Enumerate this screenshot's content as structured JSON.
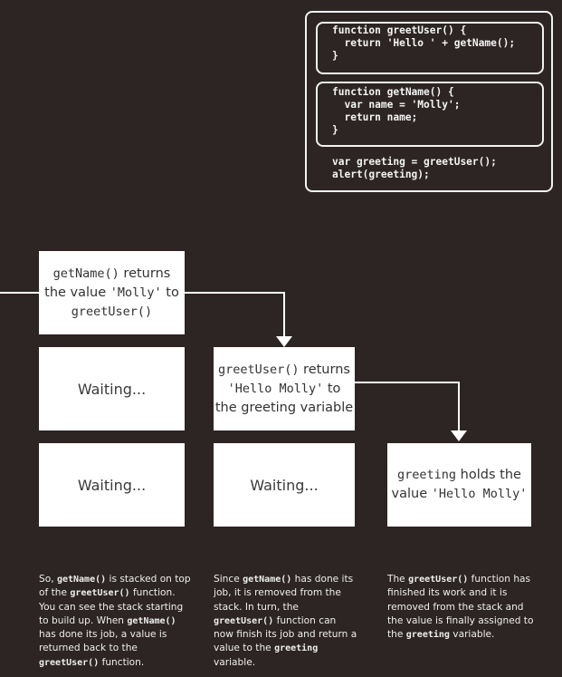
{
  "code": {
    "greet_user_lines": [
      "function greetUser() {",
      "  return 'Hello ' + getName();",
      "}"
    ],
    "get_name_lines": [
      "function getName() {",
      "  var name = 'Molly';",
      "  return name;",
      "}"
    ],
    "main_lines": [
      "var greeting = greetUser();",
      "alert(greeting);"
    ]
  },
  "boxes": {
    "col1_top": {
      "code": "getName()",
      "text1": " returns",
      "text2": "the value ",
      "code2": "'Molly'",
      "text3": " to",
      "code3": "greetUser()"
    },
    "col1_mid": {
      "text": "Waiting..."
    },
    "col1_bot": {
      "text": "Waiting..."
    },
    "col2_mid": {
      "code": "greetUser()",
      "text1": " returns",
      "code2": "'Hello Molly'",
      "text2": " to",
      "text3": "the greeting variable"
    },
    "col2_bot": {
      "text": "Waiting..."
    },
    "col3_bot": {
      "code": "greeting",
      "text1": " holds the",
      "text2": "value ",
      "code2": "'Hello Molly'"
    }
  },
  "captions": {
    "c1": {
      "p1": "So, ",
      "b1": "getName()",
      "p2": " is stacked on top of the ",
      "b2": "greetUser()",
      "p3": " function. You can see the stack starting to build up. When ",
      "b3": "getName()",
      "p4": " has done its job, a value is returned back to the ",
      "b4": "greetUser()",
      "p5": " function."
    },
    "c2": {
      "p1": "Since ",
      "b1": "getName()",
      "p2": " has done its job, it is removed from the stack. In turn, the ",
      "b2": "greetUser()",
      "p3": " function can now finish its job and return a value to the ",
      "b3": "greeting",
      "p4": " variable."
    },
    "c3": {
      "p1": "The ",
      "b1": "greetUser()",
      "p2": " function has finished its work and it is removed from the stack and the value is finally assigned to the ",
      "b2": "greeting",
      "p3": " variable."
    }
  },
  "colors": {
    "background": "#2c2523",
    "box": "#ffffff",
    "line": "#ffffff"
  }
}
